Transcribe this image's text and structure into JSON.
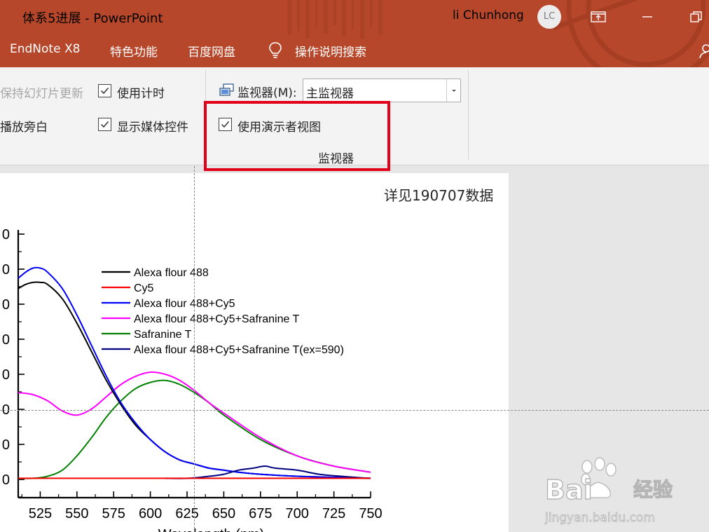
{
  "window": {
    "title": "体系5进展  -  PowerPoint",
    "user_name": "li Chunhong",
    "user_initials": "LC"
  },
  "tabs": [
    "EndNote X8",
    "特色功能",
    "百度网盘",
    "操作说明搜索"
  ],
  "ribbon": {
    "keep_updated_label": "保持幻灯片更新",
    "use_timings_label": "使用计时",
    "use_timings_checked": true,
    "play_narration_label": "播放旁白",
    "show_media_controls_label": "显示媒体控件",
    "show_media_controls_checked": true,
    "monitor_label": "监视器(M):",
    "monitor_value": "主监视器",
    "presenter_view_label": "使用演示者视图",
    "presenter_view_checked": true,
    "group_label": "监视器"
  },
  "slide": {
    "note": "详见190707数据",
    "xlabel_partial": "Wavelength (nm)"
  },
  "watermark": {
    "text": "Bai经验",
    "url": "jingyan.baidu.com"
  },
  "chart_data": {
    "type": "line",
    "xlabel": "Wavelength (nm)",
    "ylabel": "",
    "xlim": [
      510,
      750
    ],
    "x_ticks": [
      525,
      550,
      575,
      600,
      625,
      650,
      675,
      700,
      725,
      750
    ],
    "y_tick_labels": [
      "0",
      "0",
      "0",
      "0",
      "0",
      "0",
      "0",
      "0"
    ],
    "legend_position": "top-center",
    "series": [
      {
        "name": "Alexa flour 488",
        "color": "#000000",
        "x": [
          510,
          515,
          520,
          525,
          530,
          540,
          550,
          560,
          570,
          580,
          590,
          600,
          610,
          620,
          630,
          640,
          650,
          660,
          675,
          700,
          725,
          750
        ],
        "y": [
          0.93,
          0.95,
          0.96,
          0.96,
          0.95,
          0.88,
          0.76,
          0.62,
          0.48,
          0.36,
          0.26,
          0.19,
          0.13,
          0.09,
          0.07,
          0.05,
          0.04,
          0.03,
          0.02,
          0.01,
          0.005,
          0.0
        ]
      },
      {
        "name": "Cy5",
        "color": "#ff0000",
        "x": [
          510,
          550,
          600,
          650,
          700,
          750
        ],
        "y": [
          0.0,
          0.0,
          0.0,
          0.0,
          0.0,
          0.0
        ]
      },
      {
        "name": "Alexa flour 488+Cy5",
        "color": "#0000ff",
        "x": [
          510,
          515,
          520,
          525,
          530,
          540,
          550,
          560,
          570,
          580,
          590,
          600,
          610,
          620,
          630,
          640,
          650,
          660,
          675,
          700,
          725,
          750
        ],
        "y": [
          0.98,
          1.01,
          1.03,
          1.03,
          1.01,
          0.93,
          0.8,
          0.65,
          0.5,
          0.37,
          0.27,
          0.19,
          0.13,
          0.09,
          0.07,
          0.05,
          0.04,
          0.03,
          0.02,
          0.01,
          0.005,
          0.0
        ]
      },
      {
        "name": "Alexa flour 488+Cy5+Safranine T",
        "color": "#ff00ff",
        "x": [
          510,
          520,
          530,
          540,
          550,
          560,
          570,
          580,
          590,
          600,
          610,
          620,
          630,
          640,
          650,
          675,
          700,
          725,
          750
        ],
        "y": [
          0.42,
          0.41,
          0.38,
          0.33,
          0.31,
          0.34,
          0.4,
          0.46,
          0.5,
          0.52,
          0.51,
          0.48,
          0.43,
          0.37,
          0.32,
          0.2,
          0.11,
          0.06,
          0.03
        ]
      },
      {
        "name": "Safranine T",
        "color": "#008000",
        "x": [
          510,
          520,
          530,
          540,
          550,
          560,
          570,
          580,
          590,
          600,
          610,
          620,
          630,
          640,
          650,
          675,
          700,
          725,
          750
        ],
        "y": [
          0.0,
          0.0,
          0.01,
          0.04,
          0.11,
          0.2,
          0.3,
          0.38,
          0.44,
          0.47,
          0.48,
          0.46,
          0.42,
          0.37,
          0.31,
          0.19,
          0.11,
          0.06,
          0.03
        ]
      },
      {
        "name": "Alexa flour 488+Cy5+Safranine T(ex=590)",
        "color": "#000080",
        "x": [
          610,
          625,
          640,
          650,
          660,
          670,
          678,
          685,
          700,
          715,
          730,
          750
        ],
        "y": [
          0.0,
          0.0,
          0.01,
          0.02,
          0.04,
          0.05,
          0.06,
          0.05,
          0.04,
          0.02,
          0.01,
          0.0
        ]
      }
    ]
  },
  "colors": {
    "titlebar": "#b7472a",
    "ribbon": "#f3f3f3",
    "highlight": "#e3001b",
    "slide": "#ffffff",
    "workspace": "#e6e6e6"
  }
}
